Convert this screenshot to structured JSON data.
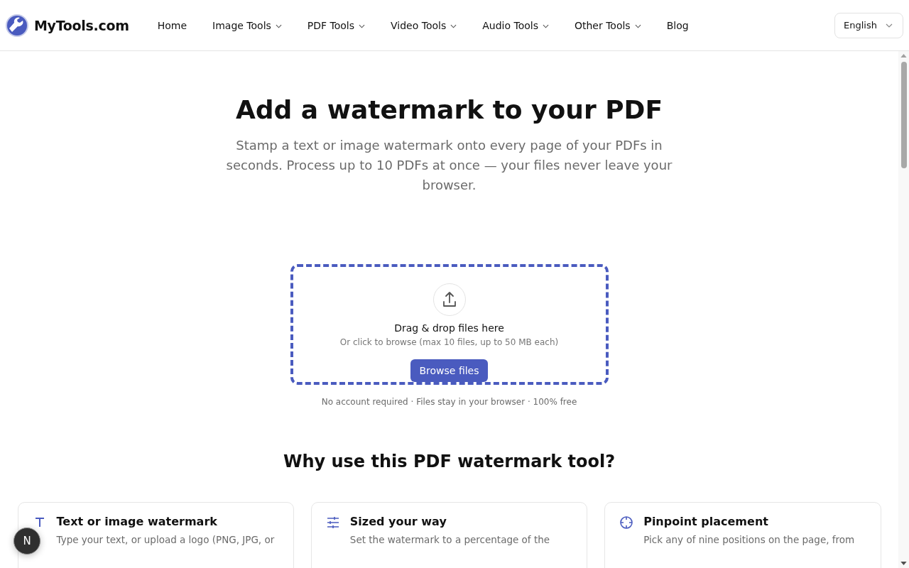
{
  "brand": {
    "name": "MyTools.com"
  },
  "nav": [
    {
      "label": "Home",
      "dropdown": false
    },
    {
      "label": "Image Tools",
      "dropdown": true
    },
    {
      "label": "PDF Tools",
      "dropdown": true
    },
    {
      "label": "Video Tools",
      "dropdown": true
    },
    {
      "label": "Audio Tools",
      "dropdown": true
    },
    {
      "label": "Other Tools",
      "dropdown": true
    },
    {
      "label": "Blog",
      "dropdown": false
    }
  ],
  "language": {
    "value": "English"
  },
  "hero": {
    "title": "Add a watermark to your PDF",
    "subtitle": "Stamp a text or image watermark onto every page of your PDFs in seconds. Process up to 10 PDFs at once — your files never leave your browser."
  },
  "dropzone": {
    "heading": "Drag & drop files here",
    "hint": "Or click to browse (max 10 files, up to 50 MB each)",
    "button": "Browse files",
    "note": "No account required · Files stay in your browser · 100% free"
  },
  "features": {
    "title": "Why use this PDF watermark tool?",
    "cards": [
      {
        "kind": "text",
        "title": "Text or image watermark",
        "body": "Type your text, or upload a logo (PNG, JPG, or"
      },
      {
        "kind": "sliders",
        "title": "Sized your way",
        "body": "Set the watermark to a percentage of the"
      },
      {
        "kind": "crosshair",
        "title": "Pinpoint placement",
        "body": "Pick any of nine positions on the page, from"
      }
    ]
  },
  "badge": {
    "letter": "N"
  }
}
